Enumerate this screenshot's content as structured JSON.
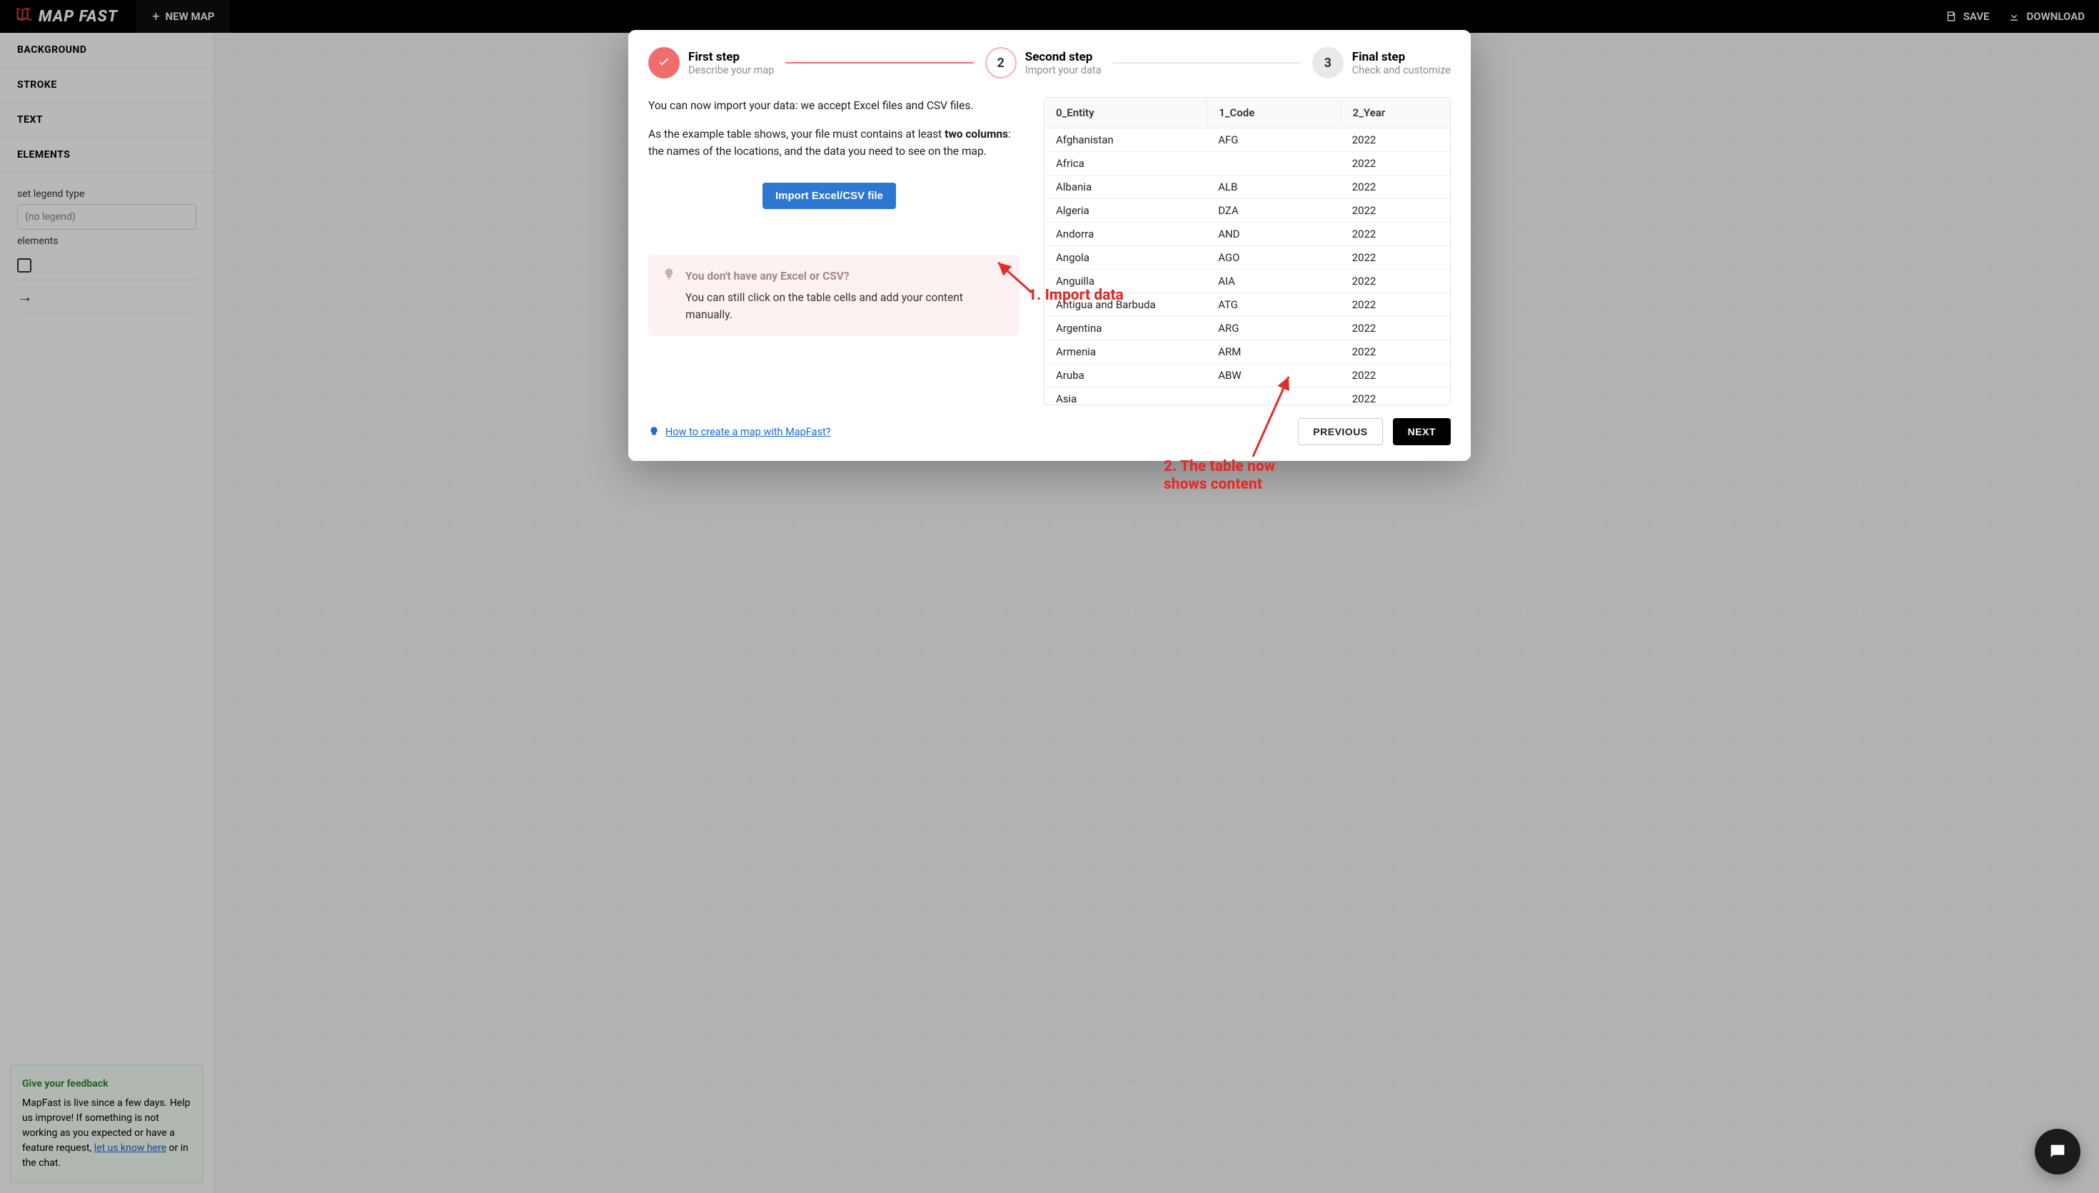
{
  "topbar": {
    "brand": "MAP FAST",
    "new_map": "NEW MAP",
    "save": "SAVE",
    "download": "DOWNLOAD"
  },
  "sidebar": {
    "panels": {
      "background": "BACKGROUND",
      "stroke": "STROKE",
      "text": "TEXT",
      "elements": "ELEMENTS"
    },
    "legend_label": "set legend type",
    "legend_placeholder": "(no legend)",
    "elements_label": "elements"
  },
  "feedback": {
    "title": "Give your feedback",
    "body_pre": "MapFast is live since a few days. Help us improve! If something is not working as you expected or have a feature request, ",
    "link": "let us know here",
    "body_post": " or in the chat."
  },
  "stepper": {
    "s1": {
      "title": "First step",
      "sub": "Describe your map"
    },
    "s2": {
      "num": "2",
      "title": "Second step",
      "sub": "Import your data"
    },
    "s3": {
      "num": "3",
      "title": "Final step",
      "sub": "Check and customize"
    }
  },
  "import": {
    "intro": "You can now import your data: we accept Excel files and CSV files.",
    "p_pre": "As the example table shows, your file must contains at least ",
    "p_bold": "two columns",
    "p_post": ": the names of the locations, and the data you need to see on the map.",
    "button": "Import Excel/CSV file",
    "hint_title": "You don't have any Excel or CSV?",
    "hint_body": "You can still click on the table cells and add your content manually."
  },
  "table": {
    "headers": [
      "0_Entity",
      "1_Code",
      "2_Year"
    ],
    "rows": [
      {
        "entity": "Afghanistan",
        "code": "AFG",
        "year": "2022"
      },
      {
        "entity": "Africa",
        "code": "",
        "year": "2022"
      },
      {
        "entity": "Albania",
        "code": "ALB",
        "year": "2022"
      },
      {
        "entity": "Algeria",
        "code": "DZA",
        "year": "2022"
      },
      {
        "entity": "Andorra",
        "code": "AND",
        "year": "2022"
      },
      {
        "entity": "Angola",
        "code": "AGO",
        "year": "2022"
      },
      {
        "entity": "Anguilla",
        "code": "AIA",
        "year": "2022"
      },
      {
        "entity": "Antigua and Barbuda",
        "code": "ATG",
        "year": "2022"
      },
      {
        "entity": "Argentina",
        "code": "ARG",
        "year": "2022"
      },
      {
        "entity": "Armenia",
        "code": "ARM",
        "year": "2022"
      },
      {
        "entity": "Aruba",
        "code": "ABW",
        "year": "2022"
      },
      {
        "entity": "Asia",
        "code": "",
        "year": "2022"
      }
    ]
  },
  "footer": {
    "howto": "How to create a map with MapFast?",
    "prev": "PREVIOUS",
    "next": "NEXT"
  },
  "annotations": {
    "a1": "1. Import data",
    "a2a": "2. The table now",
    "a2b": "shows content"
  }
}
